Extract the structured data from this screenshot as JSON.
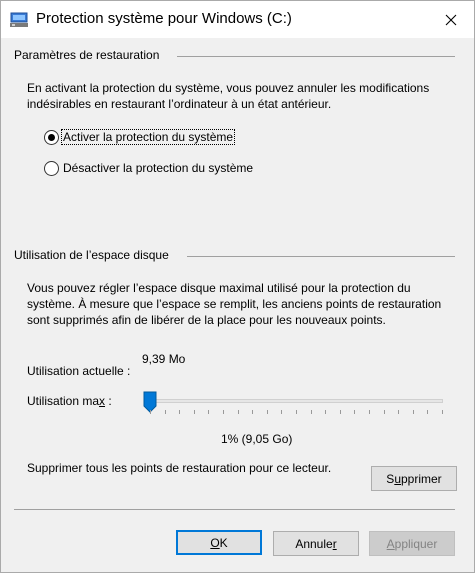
{
  "window": {
    "title": "Protection système pour Windows (C:)",
    "close_glyph": "✕"
  },
  "restore": {
    "section_title": "Paramètres de restauration",
    "description": "En activant la protection du système, vous pouvez annuler les modifications indésirables en restaurant l’ordinateur à un état antérieur.",
    "options": [
      {
        "label": "Activer la protection du système",
        "selected": true
      },
      {
        "label": "Désactiver la protection du système",
        "selected": false
      }
    ]
  },
  "disk": {
    "section_title": "Utilisation de l’espace disque",
    "description": "Vous pouvez régler l’espace disque maximal utilisé pour la protection du système. À mesure que l’espace se remplit, les anciens points de restauration sont supprimés afin de libérer de la place pour les nouveaux points.",
    "current_usage_label": "Utilisation actuelle :",
    "current_usage_value": "9,39 Mo",
    "max_usage_label_pre": "Utilisation ma",
    "max_usage_label_accel": "x",
    "max_usage_label_post": " :",
    "slider_percent": 1,
    "slider_value_text": "1% (9,05 Go)",
    "delete_text": "Supprimer tous les points de restauration pour ce lecteur.",
    "delete_button_pre": "S",
    "delete_button_accel": "u",
    "delete_button_post": "pprimer"
  },
  "footer": {
    "ok_accel": "O",
    "ok_post": "K",
    "cancel_pre": "Annule",
    "cancel_accel": "r",
    "apply_accel": "A",
    "apply_post": "ppliquer"
  }
}
